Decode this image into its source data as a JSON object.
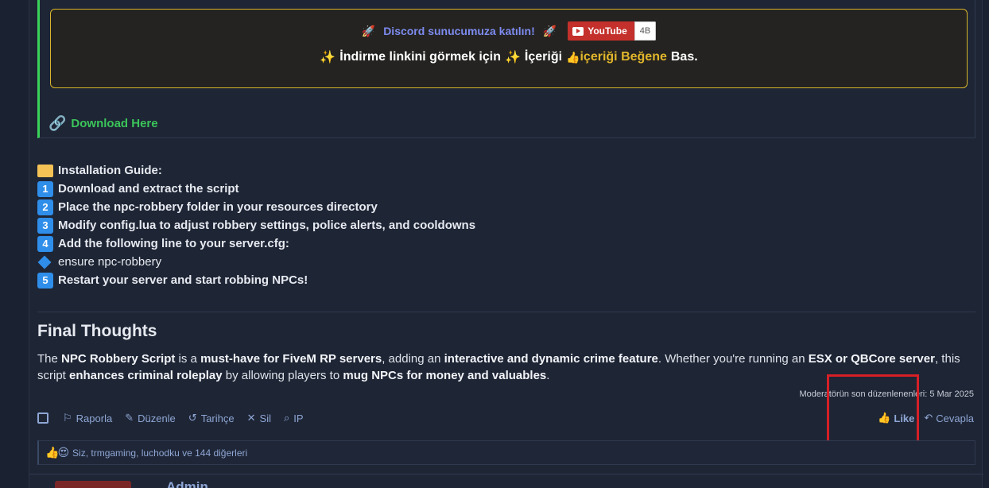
{
  "banner": {
    "discord_text": "Discord sunucumuza katılın!",
    "youtube_label": "YouTube",
    "youtube_count": "4B",
    "unlock_prefix": "İndirme linkini görmek için",
    "unlock_middle": "İçeriği",
    "unlock_link": "içeriği Beğene",
    "unlock_suffix": "Bas.",
    "download_text": "Download Here"
  },
  "guide": {
    "title": "Installation Guide:",
    "steps": [
      {
        "num": "1",
        "text": "Download and extract the script"
      },
      {
        "num": "2",
        "text": "Place the npc-robbery folder in your resources directory"
      },
      {
        "num": "3",
        "text": "Modify config.lua to adjust robbery settings, police alerts, and cooldowns"
      },
      {
        "num": "4",
        "text": "Add the following line to your server.cfg:"
      },
      {
        "num": "",
        "text": "ensure npc-robbery"
      },
      {
        "num": "5",
        "text": "Restart your server and start robbing NPCs!"
      }
    ]
  },
  "final": {
    "title": "Final Thoughts",
    "p1": "The ",
    "b1": "NPC Robbery Script",
    "p2": " is a ",
    "b2": "must-have for FiveM RP servers",
    "p3": ", adding an ",
    "b3": "interactive and dynamic crime feature",
    "p4": ". Whether you're running an ",
    "b4": "ESX or QBCore server",
    "p5": ", this script ",
    "b5": "enhances criminal roleplay",
    "p6": " by allowing players to ",
    "b6": "mug NPCs for money and valuables",
    "p7": "."
  },
  "edited": "Moderatörün son düzenlenenleri: 5 Mar 2025",
  "actions": {
    "report": "Raporla",
    "edit": "Düzenle",
    "history": "Tarihçe",
    "delete": "Sil",
    "ip": "IP",
    "like": "Like",
    "reply": "Cevapla"
  },
  "reactions": {
    "text": "Siz, trmgaming, luchodku ve 144 diğerleri"
  },
  "next_post": {
    "author": "Admin"
  },
  "colors": {
    "accent": "#8ea6d4",
    "highlight": "#d61f26",
    "gold": "#e1b62b",
    "green": "#3bc55a"
  }
}
